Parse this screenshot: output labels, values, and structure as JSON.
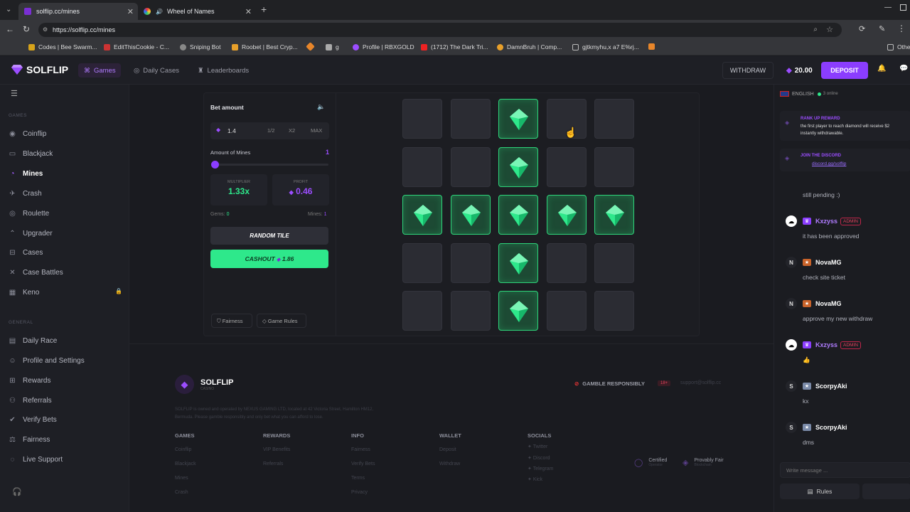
{
  "browser": {
    "tabs": [
      {
        "title": "solflip.cc/mines",
        "active": true
      },
      {
        "title": "Wheel of Names",
        "active": false
      }
    ],
    "url": "https://solflip.cc/mines",
    "bookmarks": [
      "Codes | Bee Swarm...",
      "EditThisCookie - C...",
      "Sniping Bot",
      "Roobet | Best Cryp...",
      "g",
      "Profile | RBXGOLD",
      "(1712) The Dark Tri...",
      "DamnBruh | Comp...",
      "gjtkmyhu,x a7 E%rj...",
      "Othe"
    ]
  },
  "header": {
    "logo": "SOLFLIP",
    "nav": {
      "games": "Games",
      "daily_cases": "Daily Cases",
      "leaderboards": "Leaderboards"
    },
    "withdraw": "WITHDRAW",
    "balance": "20.00",
    "deposit": "DEPOSIT"
  },
  "sidebar": {
    "games_heading": "GAMES",
    "games": [
      {
        "label": "Coinflip",
        "icon": "coin-icon"
      },
      {
        "label": "Blackjack",
        "icon": "cards-icon"
      },
      {
        "label": "Mines",
        "icon": "mine-icon",
        "active": true
      },
      {
        "label": "Crash",
        "icon": "rocket-icon"
      },
      {
        "label": "Roulette",
        "icon": "roulette-icon"
      },
      {
        "label": "Upgrader",
        "icon": "arrow-up-icon"
      },
      {
        "label": "Cases",
        "icon": "case-icon"
      },
      {
        "label": "Case Battles",
        "icon": "swords-icon"
      },
      {
        "label": "Keno",
        "icon": "grid-icon",
        "locked": true
      }
    ],
    "general_heading": "GENERAL",
    "general": [
      {
        "label": "Daily Race",
        "icon": "race-icon"
      },
      {
        "label": "Profile and Settings",
        "icon": "user-icon"
      },
      {
        "label": "Rewards",
        "icon": "gift-icon"
      },
      {
        "label": "Referrals",
        "icon": "users-icon"
      },
      {
        "label": "Verify Bets",
        "icon": "check-icon"
      },
      {
        "label": "Fairness",
        "icon": "scale-icon"
      },
      {
        "label": "Live Support",
        "icon": "support-icon"
      }
    ]
  },
  "bet": {
    "bet_amount_label": "Bet amount",
    "amount": "1.4",
    "half": "1/2",
    "double": "X2",
    "max": "MAX",
    "mines_label": "Amount of Mines",
    "mines_value": "1",
    "multiplier_label": "MULTIPLIER",
    "multiplier": "1.33x",
    "profit_label": "PROFIT",
    "profit": "0.46",
    "gems_label": "Gems:",
    "gems_value": "0",
    "mines_count_label": "Mines:",
    "mines_count_value": "1",
    "random_tile": "RANDOM TILE",
    "cashout_label": "CASHOUT",
    "cashout_value": "1.86",
    "fairness": "Fairness",
    "game_rules": "Game Rules"
  },
  "board": {
    "rows": [
      [
        false,
        false,
        true,
        false,
        false
      ],
      [
        false,
        false,
        true,
        false,
        false
      ],
      [
        true,
        true,
        true,
        true,
        true
      ],
      [
        false,
        false,
        true,
        false,
        false
      ],
      [
        false,
        false,
        true,
        false,
        false
      ]
    ]
  },
  "chat": {
    "language": "ENGLISH",
    "online": "3 online",
    "announcements": [
      {
        "title": "RANK UP REWARD",
        "text": "the first player to reach diamond will receive $2",
        "text2": "instantly withdrawable."
      },
      {
        "title": "JOIN THE DISCORD",
        "text": "discord.gg/solflip"
      }
    ],
    "messages": [
      {
        "name": "",
        "text": "still pending :)"
      },
      {
        "name": "Kxzyss",
        "admin": "ADMIN",
        "text": "it has been approved"
      },
      {
        "name": "NovaMG",
        "initial": "N",
        "text": "check site ticket"
      },
      {
        "name": "NovaMG",
        "initial": "N",
        "text": "approve my new withdraw"
      },
      {
        "name": "Kxzyss",
        "admin": "ADMIN",
        "text": "👍"
      },
      {
        "name": "ScorpyAki",
        "initial": "S",
        "text": "kx"
      },
      {
        "name": "ScorpyAki",
        "initial": "S",
        "text": "dms"
      }
    ],
    "input_placeholder": "Write message ...",
    "rules": "Rules"
  },
  "footer": {
    "logo": "SOLFLIP",
    "logo_sub": "CASINO",
    "gamble": "GAMBLE RESPONSIBLY",
    "age": "18+",
    "email": "support@solflip.cc",
    "legal1": "SOLFLIP is owned and operated by NEXUS GAMING LTD, located at 42 Victoria Street, Hamilton HM12,",
    "legal2": "Bermuda. Please gamble responsibly and only bet what you can afford to lose.",
    "columns": [
      {
        "title": "GAMES",
        "links": [
          "Coinflip",
          "Blackjack",
          "Mines",
          "Crash"
        ]
      },
      {
        "title": "REWARDS",
        "links": [
          "VIP Benefits",
          "Referrals"
        ]
      },
      {
        "title": "INFO",
        "links": [
          "Fairness",
          "Verify Bets",
          "Terms",
          "Privacy"
        ]
      },
      {
        "title": "WALLET",
        "links": [
          "Deposit",
          "Withdraw"
        ]
      },
      {
        "title": "SOCIALS",
        "links": [
          "Twitter",
          "Discord",
          "Telegram",
          "Kick"
        ]
      }
    ],
    "certified": "Certified",
    "certified_sub": "Operator",
    "provably": "Provably Fair",
    "provably_sub": "Blockchain"
  },
  "colors": {
    "accent": "#8b3dff",
    "green": "#2ee88b",
    "bg": "#1a1b20"
  }
}
